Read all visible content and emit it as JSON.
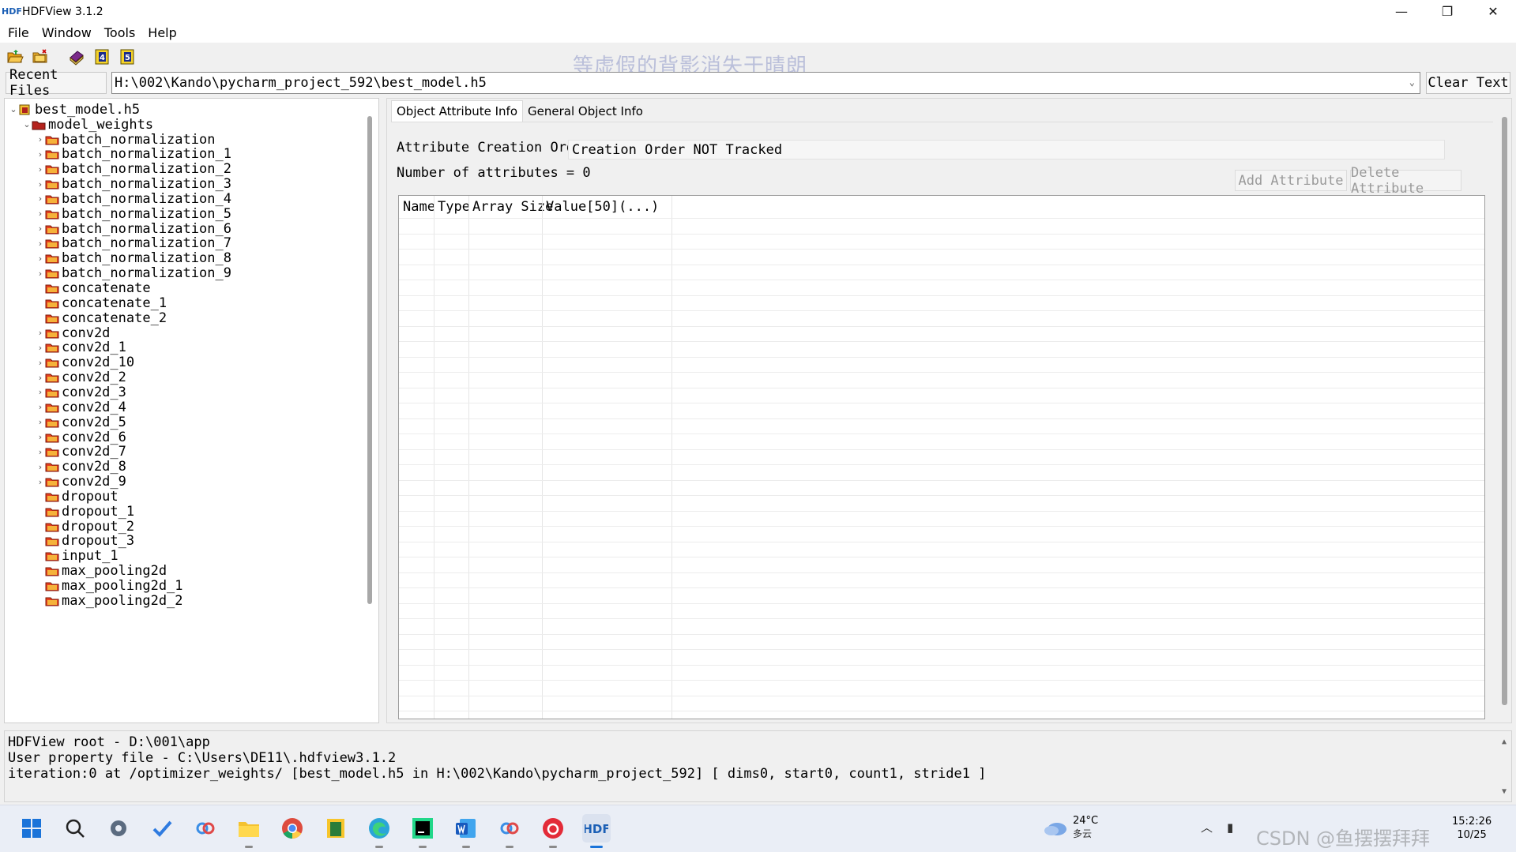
{
  "window": {
    "title": "HDFView 3.1.2",
    "logo_text": "HDF",
    "controls": {
      "minimize": "—",
      "maximize": "❐",
      "close": "✕"
    }
  },
  "menu": [
    "File",
    "Window",
    "Tools",
    "Help"
  ],
  "toolbar": {
    "icons": [
      "open-folder-icon",
      "close-folder-icon",
      "book-icon",
      "h4-icon",
      "h5-icon"
    ],
    "h4_label": "4",
    "h5_label": "5"
  },
  "watermark_text": "等虚假的背影消失于晴朗",
  "recent": {
    "label": "Recent Files",
    "path": "H:\\002\\Kando\\pycharm_project_592\\best_model.h5",
    "clear_label": "Clear Text"
  },
  "tree": {
    "root": "best_model.h5",
    "group": "model_weights",
    "items": [
      {
        "label": "batch_normalization",
        "expandable": true
      },
      {
        "label": "batch_normalization_1",
        "expandable": true
      },
      {
        "label": "batch_normalization_2",
        "expandable": true
      },
      {
        "label": "batch_normalization_3",
        "expandable": true
      },
      {
        "label": "batch_normalization_4",
        "expandable": true
      },
      {
        "label": "batch_normalization_5",
        "expandable": true
      },
      {
        "label": "batch_normalization_6",
        "expandable": true
      },
      {
        "label": "batch_normalization_7",
        "expandable": true
      },
      {
        "label": "batch_normalization_8",
        "expandable": true
      },
      {
        "label": "batch_normalization_9",
        "expandable": true
      },
      {
        "label": "concatenate",
        "expandable": false
      },
      {
        "label": "concatenate_1",
        "expandable": false
      },
      {
        "label": "concatenate_2",
        "expandable": false
      },
      {
        "label": "conv2d",
        "expandable": true
      },
      {
        "label": "conv2d_1",
        "expandable": true
      },
      {
        "label": "conv2d_10",
        "expandable": true
      },
      {
        "label": "conv2d_2",
        "expandable": true
      },
      {
        "label": "conv2d_3",
        "expandable": true
      },
      {
        "label": "conv2d_4",
        "expandable": true
      },
      {
        "label": "conv2d_5",
        "expandable": true
      },
      {
        "label": "conv2d_6",
        "expandable": true
      },
      {
        "label": "conv2d_7",
        "expandable": true
      },
      {
        "label": "conv2d_8",
        "expandable": true
      },
      {
        "label": "conv2d_9",
        "expandable": true
      },
      {
        "label": "dropout",
        "expandable": false
      },
      {
        "label": "dropout_1",
        "expandable": false
      },
      {
        "label": "dropout_2",
        "expandable": false
      },
      {
        "label": "dropout_3",
        "expandable": false
      },
      {
        "label": "input_1",
        "expandable": false
      },
      {
        "label": "max_pooling2d",
        "expandable": false
      },
      {
        "label": "max_pooling2d_1",
        "expandable": false
      },
      {
        "label": "max_pooling2d_2",
        "expandable": false
      }
    ]
  },
  "tabs": [
    "Object Attribute Info",
    "General Object Info"
  ],
  "attributes": {
    "creation_order_label": "Attribute Creation Order:",
    "creation_order_value": "Creation Order NOT Tracked",
    "count_label": "Number of attributes = 0",
    "add_label": "Add Attribute",
    "delete_label": "Delete Attribute",
    "columns": [
      "Name",
      "Type",
      "Array Size",
      "Value[50](...)"
    ]
  },
  "log": [
    "HDFView root - D:\\001\\app",
    "User property file - C:\\Users\\DE11\\.hdfview3.1.2",
    "iteration:0  at  /optimizer_weights/  [best_model.h5  in  H:\\002\\Kando\\pycharm_project_592] [ dims0, start0, count1, stride1 ]"
  ],
  "taskbar": {
    "apps": [
      "windows-start-icon",
      "search-icon",
      "settings-icon",
      "todo-icon",
      "baidu-netdisk-icon",
      "file-explorer-icon",
      "chrome-icon",
      "notes-icon",
      "edge-icon",
      "pycharm-icon",
      "word-icon",
      "baidu-netdisk-icon-2",
      "netease-music-icon",
      "hdfview-icon"
    ],
    "weather_temp": "24°C",
    "weather_desc": "多云",
    "time": "15:2:26",
    "date": "10/25",
    "watermark": "CSDN @鱼摆摆拜拜"
  }
}
